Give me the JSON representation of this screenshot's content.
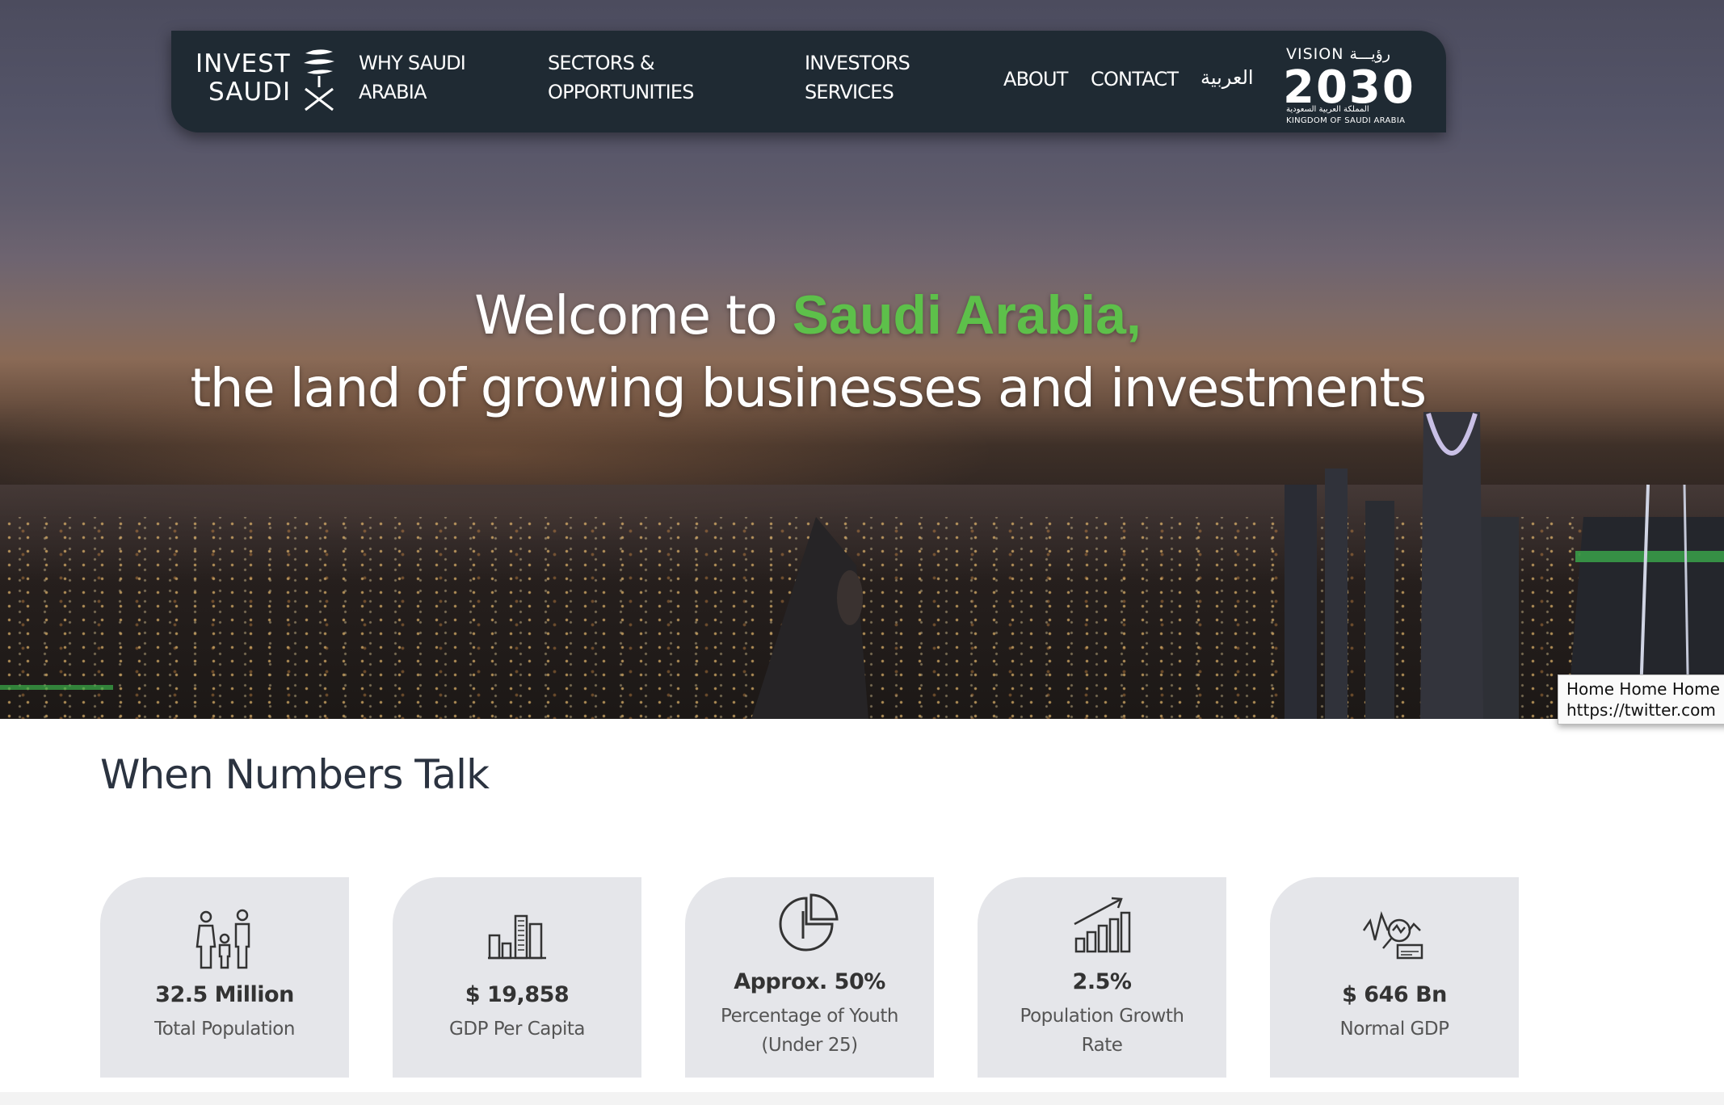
{
  "nav": {
    "logo": {
      "line1": "INVEST",
      "line2": "SAUDI"
    },
    "items": [
      {
        "line1": "WHY SAUDI",
        "line2": "ARABIA"
      },
      {
        "line1": "SECTORS &",
        "line2": "OPPORTUNITIES"
      },
      {
        "line1": "INVESTORS",
        "line2": "SERVICES"
      }
    ],
    "about": "ABOUT",
    "contact": "CONTACT",
    "arabic": "العربية",
    "vision": {
      "top": "VISION رؤيـــة",
      "year": "2030",
      "sub_ar": "المملكة العربية السعودية",
      "sub_en": "KINGDOM OF SAUDI ARABIA"
    }
  },
  "hero": {
    "line1_prefix": "Welcome to ",
    "line1_highlight": "Saudi Arabia,",
    "line2": "the land of growing businesses and investments"
  },
  "tooltip": {
    "line1": "Home Home Home",
    "line2": "https://twitter.com"
  },
  "numbers": {
    "title": "When Numbers Talk",
    "cards": [
      {
        "icon": "family-icon",
        "value": "32.5 Million",
        "label1": "Total Population",
        "label2": ""
      },
      {
        "icon": "buildings-chart-icon",
        "value": "$ 19,858",
        "label1": "GDP Per Capita",
        "label2": ""
      },
      {
        "icon": "pie-chart-icon",
        "value": "Approx. 50%",
        "label1": "Percentage of Youth",
        "label2": "(Under 25)"
      },
      {
        "icon": "growth-chart-icon",
        "value": "2.5%",
        "label1": "Population Growth",
        "label2": "Rate"
      },
      {
        "icon": "analytics-magnifier-icon",
        "value": "$ 646 Bn",
        "label1": "Normal GDP",
        "label2": ""
      }
    ]
  },
  "colors": {
    "nav_bg": "#1f2a33",
    "accent_green": "#5dc04a",
    "card_bg": "#e5e6ea",
    "title_text": "#2b3340"
  }
}
